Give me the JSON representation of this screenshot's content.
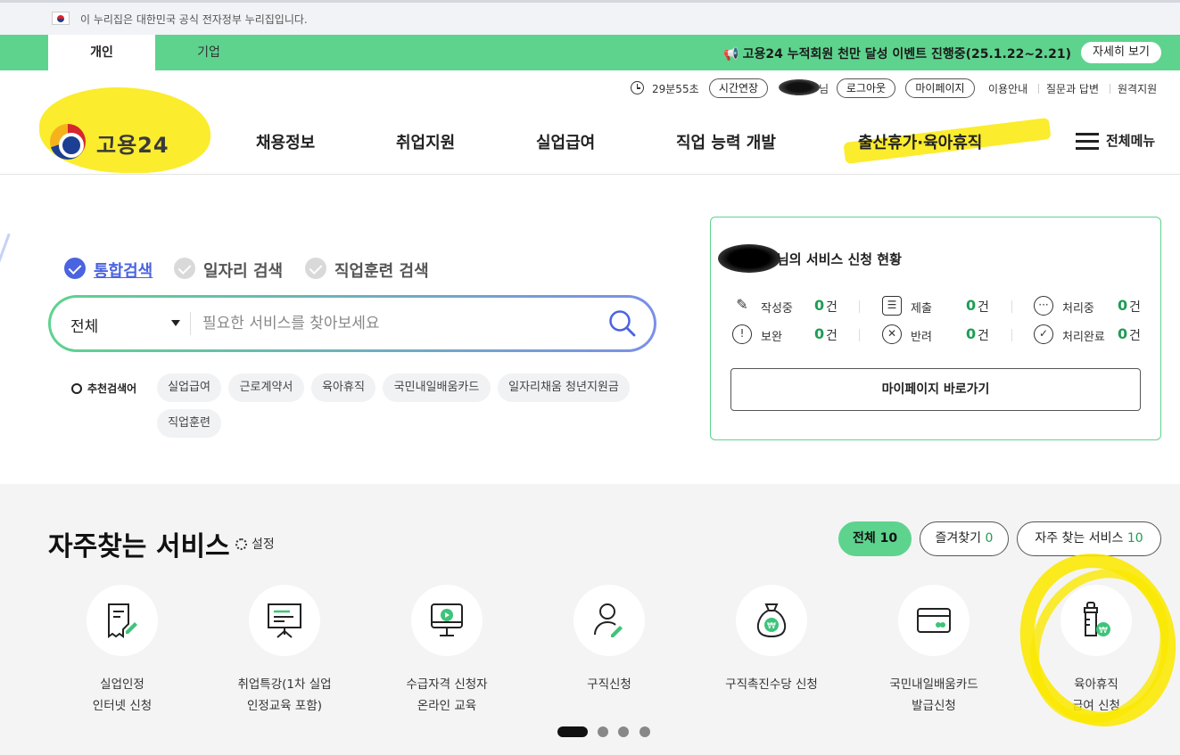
{
  "gov_banner": {
    "text": "이 누리집은 대한민국 공식 전자정부 누리집입니다."
  },
  "top_tabs": {
    "personal": "개인",
    "company": "기업"
  },
  "event": {
    "text": "고용24 누적회원 천만 달성 이벤트 진행중(25.1.22~2.21)",
    "button": "자세히 보기"
  },
  "util": {
    "timer": "29분55초",
    "extend": "시간연장",
    "user_suffix": "님",
    "logout": "로그아웃",
    "mypage": "마이페이지",
    "guide": "이용안내",
    "qna": "질문과 답변",
    "remote": "원격지원"
  },
  "logo": {
    "name": "고용24"
  },
  "nav": {
    "items": [
      "채용정보",
      "취업지원",
      "실업급여",
      "직업 능력 개발",
      "출산휴가·육아휴직"
    ],
    "all_menu": "전체메뉴"
  },
  "search": {
    "tabs": [
      "통합검색",
      "일자리 검색",
      "직업훈련 검색"
    ],
    "category": "전체",
    "placeholder": "필요한 서비스를 찾아보세요",
    "recommend_label": "추천검색어",
    "keywords": [
      "실업급여",
      "근로계약서",
      "육아휴직",
      "국민내일배움카드",
      "일자리채움 청년지원금",
      "직업훈련"
    ]
  },
  "status": {
    "title": "님의 서비스 신청 현황",
    "unit": "건",
    "items": [
      {
        "label": "작성중",
        "count": "0"
      },
      {
        "label": "제출",
        "count": "0"
      },
      {
        "label": "처리중",
        "count": "0"
      },
      {
        "label": "보완",
        "count": "0"
      },
      {
        "label": "반려",
        "count": "0"
      },
      {
        "label": "처리완료",
        "count": "0"
      }
    ],
    "mypage_button": "마이페이지 바로가기"
  },
  "services": {
    "title": "자주찾는 서비스",
    "settings": "설정",
    "filters": [
      {
        "label": "전체",
        "count": "10"
      },
      {
        "label": "즐겨찾기",
        "count": "0"
      },
      {
        "label": "자주 찾는 서비스",
        "count": "10"
      }
    ],
    "items": [
      {
        "line1": "실업인정",
        "line2": "인터넷 신청"
      },
      {
        "line1": "취업특강(1차 실업",
        "line2": "인정교육 포함)"
      },
      {
        "line1": "수급자격 신청자",
        "line2": "온라인 교육"
      },
      {
        "line1": "구직신청",
        "line2": ""
      },
      {
        "line1": "구직촉진수당 신청",
        "line2": ""
      },
      {
        "line1": "국민내일배움카드",
        "line2": "발급신청"
      },
      {
        "line1": "육아휴직",
        "line2": "급여 신청"
      }
    ],
    "page": 1,
    "page_count": 4
  },
  "colors": {
    "brand_green": "#5ed38e",
    "accent_blue": "#4a63e0",
    "count_green": "#1f9d55",
    "highlight": "#fae800"
  }
}
